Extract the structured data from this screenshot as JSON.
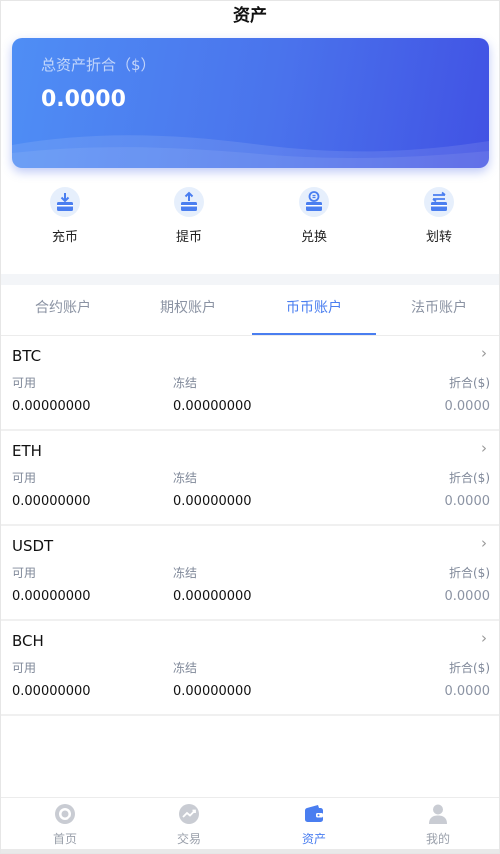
{
  "header": {
    "title": "资产"
  },
  "asset_card": {
    "label": "总资产折合（$）",
    "value": "0.0000"
  },
  "actions": [
    {
      "label": "充币",
      "icon": "deposit-icon"
    },
    {
      "label": "提币",
      "icon": "withdraw-icon"
    },
    {
      "label": "兑换",
      "icon": "exchange-icon"
    },
    {
      "label": "划转",
      "icon": "transfer-icon"
    }
  ],
  "tabs": [
    {
      "label": "合约账户",
      "active": false
    },
    {
      "label": "期权账户",
      "active": false
    },
    {
      "label": "币币账户",
      "active": true
    },
    {
      "label": "法币账户",
      "active": false
    }
  ],
  "columns": {
    "available": "可用",
    "frozen": "冻结",
    "converted": "折合($)"
  },
  "coins": [
    {
      "name": "BTC",
      "available": "0.00000000",
      "frozen": "0.00000000",
      "converted": "0.0000"
    },
    {
      "name": "ETH",
      "available": "0.00000000",
      "frozen": "0.00000000",
      "converted": "0.0000"
    },
    {
      "name": "USDT",
      "available": "0.00000000",
      "frozen": "0.00000000",
      "converted": "0.0000"
    },
    {
      "name": "BCH",
      "available": "0.00000000",
      "frozen": "0.00000000",
      "converted": "0.0000"
    }
  ],
  "nav": [
    {
      "label": "首页",
      "icon": "home-icon",
      "active": false
    },
    {
      "label": "交易",
      "icon": "trade-chart-icon",
      "active": false
    },
    {
      "label": "资产",
      "icon": "wallet-icon",
      "active": true
    },
    {
      "label": "我的",
      "icon": "profile-icon",
      "active": false
    }
  ],
  "colors": {
    "accent": "#4a7ef0",
    "card_gradient_start": "#4f8ef5",
    "card_gradient_end": "#4152e4",
    "icon_bg": "#e6effc"
  }
}
